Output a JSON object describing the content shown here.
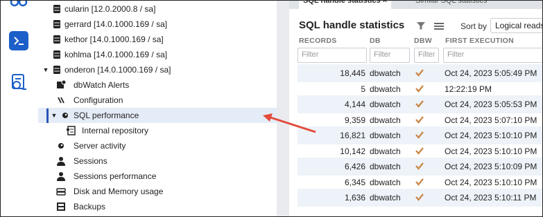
{
  "tree": {
    "items": [
      {
        "label": "cularin [12.0.2000.8 / sa]",
        "icon": "database-icon"
      },
      {
        "label": "gerrard [14.0.1000.169 / sa]",
        "icon": "database-icon"
      },
      {
        "label": "kethor [14.0.1000.169 / sa]",
        "icon": "database-icon"
      },
      {
        "label": "kohlma [14.0.1000.169 / sa]",
        "icon": "database-icon"
      },
      {
        "label": "onderon [14.0.1000.169 / sa]",
        "icon": "database-icon"
      },
      {
        "label": "dbWatch Alerts",
        "icon": "alerts-icon"
      },
      {
        "label": "Configuration",
        "icon": "configuration-icon"
      },
      {
        "label": "SQL performance",
        "icon": "gauge-icon"
      },
      {
        "label": "Internal repository",
        "icon": "repository-icon"
      },
      {
        "label": "Server activity",
        "icon": "gauge-icon"
      },
      {
        "label": "Sessions",
        "icon": "user-icon"
      },
      {
        "label": "Sessions performance",
        "icon": "user-icon"
      },
      {
        "label": "Disk and Memory usage",
        "icon": "disk-icon"
      },
      {
        "label": "Backups",
        "icon": "backup-icon"
      }
    ]
  },
  "panel": {
    "tabs": [
      "SQL handle statistics ×",
      "Similar SQL statistics"
    ],
    "title": "SQL handle statistics",
    "sort_label": "Sort by",
    "sort_value": "Logical reads",
    "columns": [
      "RECORDS",
      "DB",
      "DBW",
      "FIRST EXECUTION"
    ],
    "filter_placeholder": "Filter",
    "rows": [
      {
        "records": "18,445",
        "db": "dbwatch",
        "first": "Oct 24, 2023 5:05:49 PM"
      },
      {
        "records": "5",
        "db": "dbwatch",
        "first": "12:22:19 PM"
      },
      {
        "records": "4,144",
        "db": "dbwatch",
        "first": "Oct 24, 2023 5:05:53 PM"
      },
      {
        "records": "9,359",
        "db": "dbwatch",
        "first": "Oct 24, 2023 5:07:10 PM"
      },
      {
        "records": "16,821",
        "db": "dbwatch",
        "first": "Oct 24, 2023 5:10:10 PM"
      },
      {
        "records": "10,142",
        "db": "dbwatch",
        "first": "Oct 24, 2023 5:10:10 PM"
      },
      {
        "records": "6,426",
        "db": "dbwatch",
        "first": "Oct 24, 2023 5:10:09 PM"
      },
      {
        "records": "6,345",
        "db": "dbwatch",
        "first": "Oct 24, 2023 5:10:10 PM"
      },
      {
        "records": "1,636",
        "db": "dbwatch",
        "first": "Oct 24, 2023 5:10:11 PM"
      }
    ]
  },
  "colors": {
    "accent": "#1c5fc9",
    "selection": "#e4ecf7",
    "check": "#c9894a",
    "arrow": "#e34b3c"
  }
}
